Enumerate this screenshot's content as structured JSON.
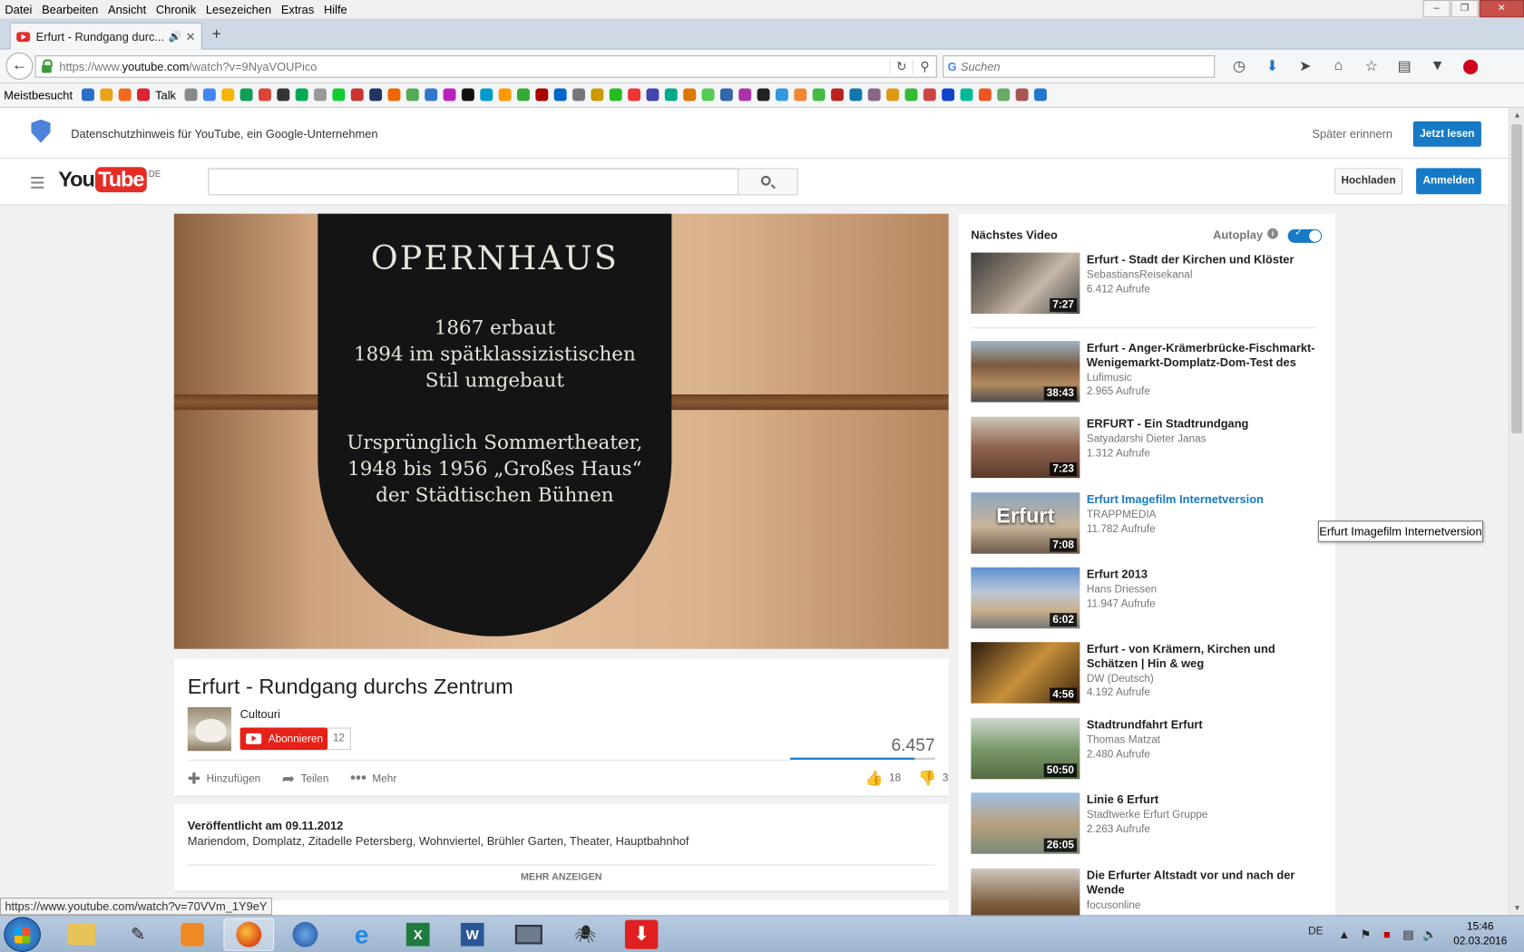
{
  "menubar": [
    "Datei",
    "Bearbeiten",
    "Ansicht",
    "Chronik",
    "Lesezeichen",
    "Extras",
    "Hilfe"
  ],
  "tab": {
    "title": "Erfurt - Rundgang durc...",
    "speaker_icon": "speaker-icon"
  },
  "nav": {
    "url_prefix": "https://www.",
    "url_domain": "youtube.com",
    "url_path": "/watch?v=9NyaVOUPico",
    "search_placeholder": "Suchen"
  },
  "bookmarks": {
    "folder": "Meistbesucht",
    "talk": "Talk"
  },
  "privacy": {
    "text": "Datenschutzhinweis für YouTube, ein Google-Unternehmen",
    "later": "Später erinnern",
    "read": "Jetzt lesen"
  },
  "masthead": {
    "logo_you": "You",
    "logo_tube": "Tube",
    "country": "DE",
    "upload": "Hochladen",
    "signin": "Anmelden"
  },
  "video": {
    "plaque_title": "OPERNHAUS",
    "plaque_lines1": [
      "1867 erbaut",
      "1894 im spätklassizistischen",
      "Stil umgebaut"
    ],
    "plaque_lines2": [
      "Ursprünglich Sommertheater,",
      "1948 bis 1956 „Großes Haus“",
      "der Städtischen Bühnen"
    ],
    "title": "Erfurt - Rundgang durchs Zentrum",
    "channel": "Cultouri",
    "subscribe": "Abonnieren",
    "subscribers": "12",
    "views": "6.457",
    "add": "Hinzufügen",
    "share": "Teilen",
    "more": "Mehr",
    "likes": "18",
    "dislikes": "3",
    "like_ratio": 0.857
  },
  "description": {
    "published": "Veröffentlicht am 09.11.2012",
    "text": "Mariendom, Domplatz, Zitadelle Petersberg, Wohnviertel, Brühler Garten, Theater, Hauptbahnhof",
    "show_more": "MEHR ANZEIGEN"
  },
  "sidebar": {
    "next_label": "Nächstes Video",
    "autoplay_label": "Autoplay",
    "autoplay_on": true,
    "videos": [
      {
        "title": "Erfurt - Stadt der Kirchen und Klöster",
        "channel": "SebastiansReisekanal",
        "views": "6.412 Aufrufe",
        "duration": "7:27"
      },
      {
        "title": "Erfurt - Anger-Krämerbrücke-Fischmarkt-Wenigemarkt-Domplatz-Dom-Test des",
        "channel": "Lufimusic",
        "views": "2.965 Aufrufe",
        "duration": "38:43"
      },
      {
        "title": "ERFURT - Ein Stadtrundgang",
        "channel": "Satyadarshi Dieter Janas",
        "views": "1.312 Aufrufe",
        "duration": "7:23"
      },
      {
        "title": "Erfurt Imagefilm Internetversion",
        "channel": "TRAPPMEDIA",
        "views": "11.782 Aufrufe",
        "duration": "7:08",
        "thumb_text": "Erfurt"
      },
      {
        "title": "Erfurt 2013",
        "channel": "Hans Driessen",
        "views": "11.947 Aufrufe",
        "duration": "6:02"
      },
      {
        "title": "Erfurt - von Krämern, Kirchen und Schätzen | Hin & weg",
        "channel": "DW (Deutsch)",
        "views": "4.192 Aufrufe",
        "duration": "4:56"
      },
      {
        "title": "Stadtrundfahrt Erfurt",
        "channel": "Thomas Matzat",
        "views": "2.480 Aufrufe",
        "duration": "50:50"
      },
      {
        "title": "Linie 6 Erfurt",
        "channel": "Stadtwerke Erfurt Gruppe",
        "views": "2.263 Aufrufe",
        "duration": "26:05"
      },
      {
        "title": "Die Erfurter Altstadt vor und nach der Wende",
        "channel": "focusonline",
        "views": "",
        "duration": ""
      }
    ]
  },
  "tooltip": "Erfurt Imagefilm Internetversion",
  "status_link": "https://www.youtube.com/watch?v=70VVm_1Y9eY",
  "taskbar": {
    "lang": "DE",
    "time": "15:46",
    "date": "02.03.2016"
  }
}
